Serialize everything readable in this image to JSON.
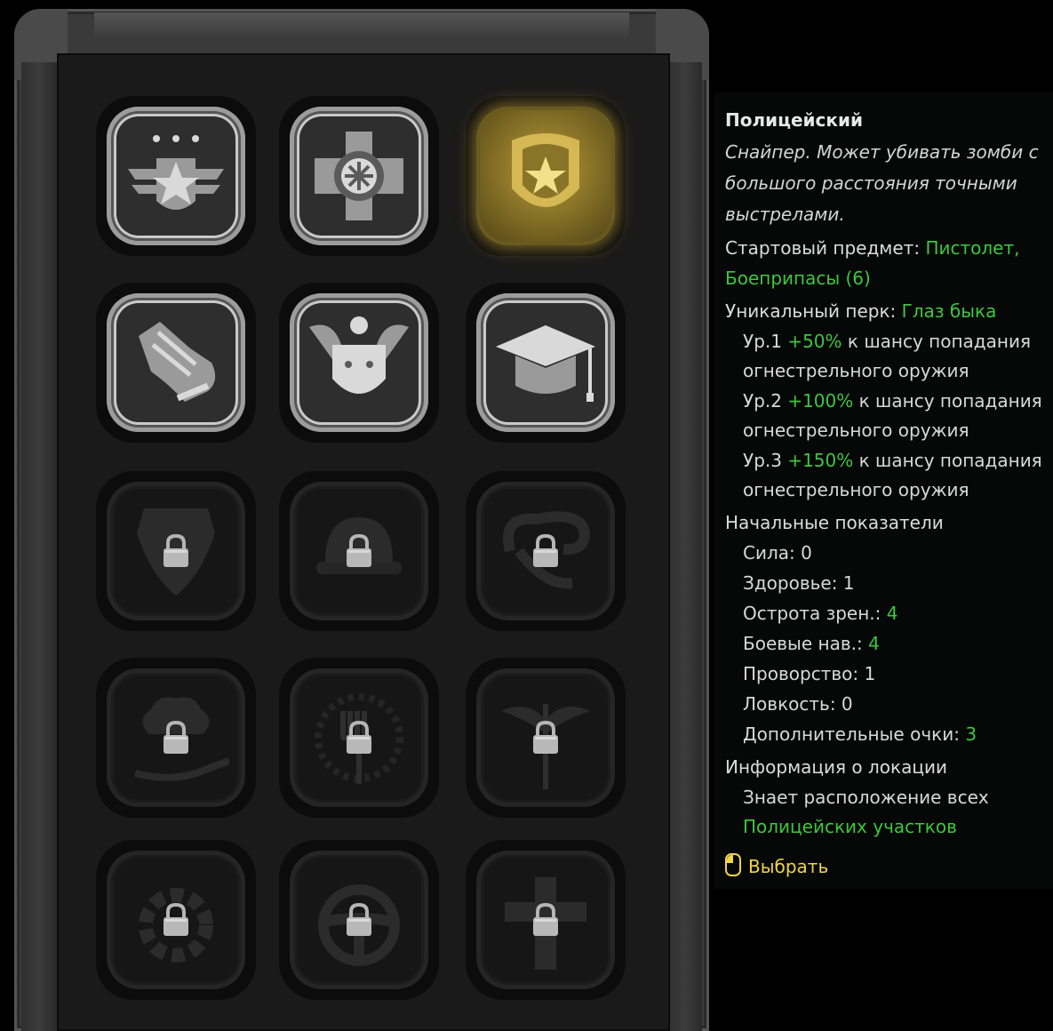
{
  "professions": [
    {
      "id": "veteran",
      "icon": "veteran-badge-icon",
      "state": "unlocked"
    },
    {
      "id": "firefighter",
      "icon": "fire-department-emblem-icon",
      "state": "unlocked"
    },
    {
      "id": "police",
      "icon": "police-badge-icon",
      "state": "selected"
    },
    {
      "id": "runner",
      "icon": "sneaker-icon",
      "state": "unlocked"
    },
    {
      "id": "guard",
      "icon": "eagle-shield-icon",
      "state": "unlocked"
    },
    {
      "id": "student",
      "icon": "graduation-cap-icon",
      "state": "unlocked"
    },
    {
      "id": "ranger",
      "icon": "ranger-patch-icon",
      "state": "locked"
    },
    {
      "id": "builder",
      "icon": "hard-hat-icon",
      "state": "locked"
    },
    {
      "id": "cowboy",
      "icon": "lasso-icon",
      "state": "locked"
    },
    {
      "id": "chef",
      "icon": "chef-hat-pan-icon",
      "state": "locked"
    },
    {
      "id": "farmer",
      "icon": "pitchfork-wreath-icon",
      "state": "locked"
    },
    {
      "id": "doctor",
      "icon": "caduceus-icon",
      "state": "locked"
    },
    {
      "id": "mechanic",
      "icon": "gear-icon",
      "state": "locked"
    },
    {
      "id": "driver",
      "icon": "steering-wheel-icon",
      "state": "locked"
    },
    {
      "id": "priest",
      "icon": "cross-icon",
      "state": "locked"
    }
  ],
  "tooltip": {
    "title": "Полицейский",
    "desc": [
      "Снайпер. Может убивать зомби с",
      "большого расстояния точными",
      "выстрелами."
    ],
    "start_item_label": "Стартовый предмет: ",
    "start_item_value_1": "Пистолет,",
    "start_item_value_2": "Боеприпасы (6)",
    "perk_label": "Уникальный перк: ",
    "perk_value": "Глаз быка",
    "levels": [
      {
        "lv": "Ур.1 ",
        "bonus": "+50%",
        "text": " к шансу попадания",
        "text2": "огнестрельного оружия"
      },
      {
        "lv": "Ур.2 ",
        "bonus": "+100%",
        "text": " к шансу попадания",
        "text2": "огнестрельного оружия"
      },
      {
        "lv": "Ур.3 ",
        "bonus": "+150%",
        "text": " к шансу попадания",
        "text2": "огнестрельного оружия"
      }
    ],
    "stats_title": "Начальные показатели",
    "stats": [
      {
        "label": "Сила: ",
        "value": "0",
        "highlight": false
      },
      {
        "label": "Здоровье: ",
        "value": "1",
        "highlight": false
      },
      {
        "label": "Острота зрен.: ",
        "value": "4",
        "highlight": true
      },
      {
        "label": "Боевые нав.: ",
        "value": "4",
        "highlight": true
      },
      {
        "label": "Проворство: ",
        "value": "1",
        "highlight": false
      },
      {
        "label": "Ловкость: ",
        "value": "0",
        "highlight": false
      },
      {
        "label": "Дополнительные очки: ",
        "value": "3",
        "highlight": true
      }
    ],
    "location_title": "Информация о локации",
    "location_text_1": "Знает расположение всех",
    "location_text_2": "Полицейских участков",
    "select_label": "Выбрать",
    "select_icon": "mouse-left-click-icon"
  },
  "colors": {
    "accent_green": "#3ec63e",
    "accent_yellow": "#f0d34a",
    "selected_gold": "#b79a3a"
  }
}
